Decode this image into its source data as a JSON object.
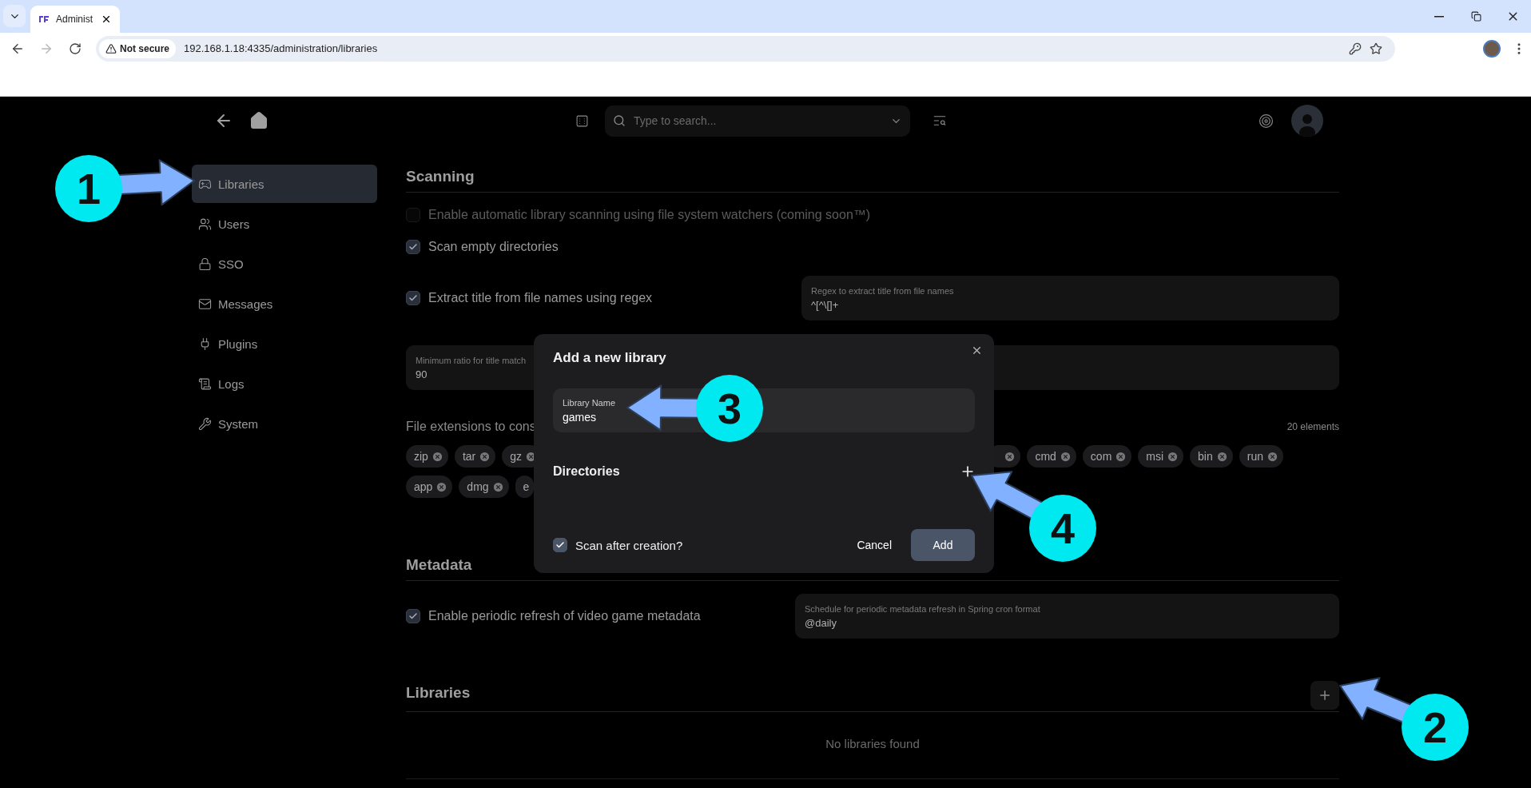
{
  "browser": {
    "tab": {
      "title": "Administ"
    },
    "nav": {
      "forward_enabled": false
    },
    "security": "Not secure",
    "url": "192.168.1.18:4335/administration/libraries"
  },
  "header": {
    "search": {
      "placeholder": "Type to search..."
    }
  },
  "sidebar": {
    "items": [
      {
        "label": "Libraries",
        "selected": true
      },
      {
        "label": "Users",
        "selected": false
      },
      {
        "label": "SSO",
        "selected": false
      },
      {
        "label": "Messages",
        "selected": false
      },
      {
        "label": "Plugins",
        "selected": false
      },
      {
        "label": "Logs",
        "selected": false
      },
      {
        "label": "System",
        "selected": false
      }
    ]
  },
  "scanning": {
    "title": "Scanning",
    "options": [
      {
        "label": "Enable automatic library scanning using file system watchers (coming soon™)",
        "checked": false,
        "disabled": true
      },
      {
        "label": "Scan empty directories",
        "checked": true,
        "disabled": false
      },
      {
        "label": "Extract title from file names using regex",
        "checked": true,
        "disabled": false,
        "field": {
          "label": "Regex to extract title from file names",
          "value": "^[^\\[]+"
        }
      }
    ],
    "ratio_field": {
      "label": "Minimum ratio for title match",
      "value": "90"
    },
    "file_extensions": {
      "label": "File extensions to cons",
      "count": "20 elements",
      "rows": [
        {
          "chips": [
            "zip",
            "tar",
            "gz"
          ],
          "right_chips": [
            "cmd",
            "com",
            "msi",
            "bin",
            "run"
          ]
        },
        {
          "chips": [
            "app",
            "dmg"
          ],
          "cut_chip": "e"
        }
      ]
    }
  },
  "metadata": {
    "title": "Metadata",
    "options": [
      {
        "label": "Enable periodic refresh of video game metadata",
        "checked": true,
        "disabled": false,
        "field": {
          "label": "Schedule for periodic metadata refresh in Spring cron format",
          "value": "@daily"
        }
      }
    ]
  },
  "libraries": {
    "title": "Libraries",
    "empty": "No libraries found"
  },
  "dialog": {
    "title": "Add a new library",
    "name_field": {
      "label": "Library Name",
      "value": "games"
    },
    "directories": "Directories",
    "scan_after": {
      "label": "Scan after creation?",
      "checked": true
    },
    "cancel": "Cancel",
    "add": "Add"
  },
  "annotations": [
    {
      "number": "1"
    },
    {
      "number": "2"
    },
    {
      "number": "3"
    },
    {
      "number": "4"
    }
  ]
}
